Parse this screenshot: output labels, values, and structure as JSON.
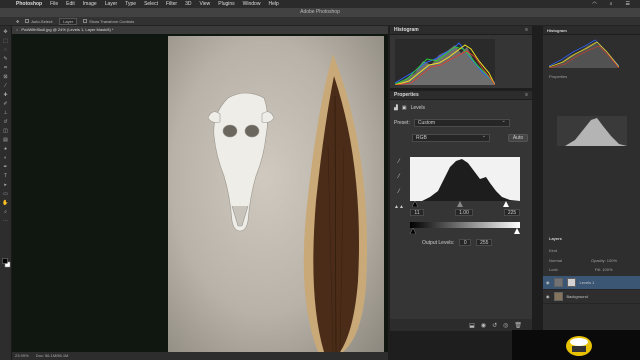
{
  "menubar": {
    "app": "Photoshop",
    "items": [
      "File",
      "Edit",
      "Image",
      "Layer",
      "Type",
      "Select",
      "Filter",
      "3D",
      "View",
      "Plugins",
      "Window",
      "Help"
    ]
  },
  "titlebar": {
    "title": "Adobe Photoshop"
  },
  "options": {
    "auto_select": "Auto-Select:",
    "layer": "Layer",
    "show_transform": "Show Transform Controls"
  },
  "document": {
    "tab": "PodWithSkull.jpg @ 24% (Levels 1, Layer Mask/8) *",
    "zoom": "23.99%",
    "doc_size": "Doc: 56.1M/56.1M"
  },
  "histogram": {
    "title": "Histogram"
  },
  "properties": {
    "title": "Properties",
    "adj_name": "Levels",
    "preset_label": "Preset:",
    "preset_value": "Custom",
    "channel": "RGB",
    "auto": "Auto",
    "input_black": "11",
    "input_gamma": "1.00",
    "input_white": "225",
    "output_label": "Output Levels:",
    "output_black": "0",
    "output_white": "255"
  },
  "right_panels": {
    "histogram": "Histogram",
    "properties": "Properties",
    "layers": "Layers",
    "kind": "Kind",
    "blend": "Normal",
    "opacity": "Opacity: 100%",
    "lock": "Lock:",
    "fill": "Fill: 100%",
    "layer1": "Levels 1",
    "background": "Background"
  }
}
